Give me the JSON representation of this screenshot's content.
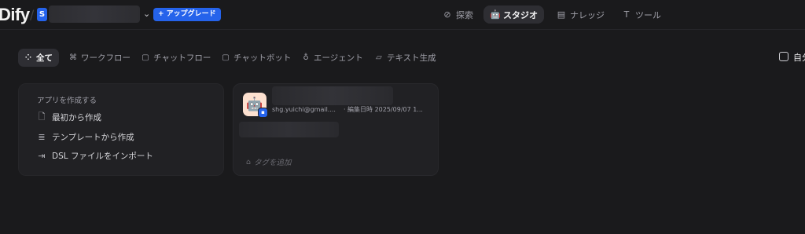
{
  "header": {
    "logo": "Dify",
    "workspace_initial": "S",
    "upgrade_label": "+ アップグレード",
    "nav": [
      {
        "label": "探索",
        "icon": "compass-icon"
      },
      {
        "label": "スタジオ",
        "icon": "robot-icon",
        "active": true
      },
      {
        "label": "ナレッジ",
        "icon": "book-icon"
      },
      {
        "label": "ツール",
        "icon": "hammer-icon"
      }
    ]
  },
  "filters": {
    "tabs": [
      {
        "label": "全て",
        "icon": "grid-icon",
        "active": true
      },
      {
        "label": "ワークフロー",
        "icon": "workflow-icon"
      },
      {
        "label": "チャットフロー",
        "icon": "chatflow-icon"
      },
      {
        "label": "チャットボット",
        "icon": "chatbot-icon"
      },
      {
        "label": "エージェント",
        "icon": "agent-icon"
      },
      {
        "label": "テキスト生成",
        "icon": "text-icon"
      }
    ],
    "mine_label": "自分"
  },
  "create_card": {
    "title": "アプリを作成する",
    "items": [
      {
        "label": "最初から作成",
        "icon": "file-plus-icon"
      },
      {
        "label": "テンプレートから作成",
        "icon": "template-icon"
      },
      {
        "label": "DSL ファイルをインポート",
        "icon": "import-icon"
      }
    ]
  },
  "app_card": {
    "author": "shg.yuichi@gmail....",
    "edited": "· 編集日時 2025/09/07 1...",
    "tag_placeholder": "タグを追加"
  },
  "colors": {
    "accent": "#2563eb",
    "background": "#1a1a1c",
    "card": "#212124"
  }
}
